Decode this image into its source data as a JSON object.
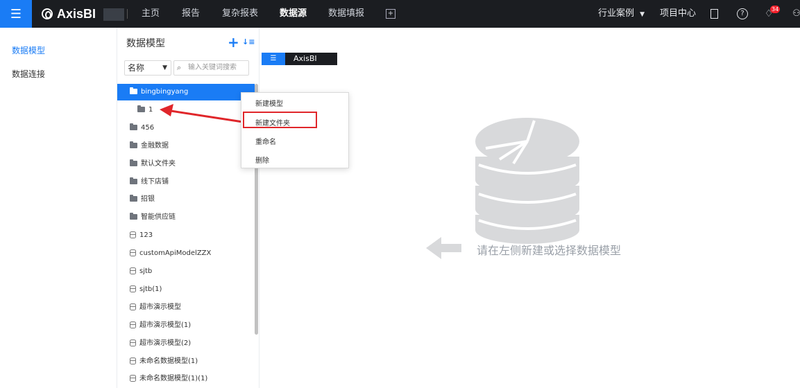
{
  "topbar": {
    "app_name": "AxisBI",
    "nav": [
      {
        "label": "主页",
        "active": false
      },
      {
        "label": "报告",
        "active": false
      },
      {
        "label": "复杂报表",
        "active": false
      },
      {
        "label": "数据源",
        "active": true
      },
      {
        "label": "数据填报",
        "active": false
      }
    ],
    "industry_cases": "行业案例",
    "project_center": "项目中心",
    "notification_count": "34"
  },
  "leftnav": {
    "items": [
      {
        "label": "数据模型",
        "active": true
      },
      {
        "label": "数据连接",
        "active": false
      }
    ]
  },
  "panel": {
    "title": "数据模型",
    "filter_field": "名称",
    "search_placeholder": "输入关键词搜索",
    "tree": [
      {
        "label": "bingbingyang",
        "type": "folder",
        "level": 0,
        "selected": true
      },
      {
        "label": "1",
        "type": "folder",
        "level": 1,
        "selected": false
      },
      {
        "label": "456",
        "type": "folder",
        "level": 0,
        "selected": false
      },
      {
        "label": "金融数据",
        "type": "folder",
        "level": 0,
        "selected": false
      },
      {
        "label": "默认文件夹",
        "type": "folder",
        "level": 0,
        "selected": false
      },
      {
        "label": "线下店铺",
        "type": "folder",
        "level": 0,
        "selected": false
      },
      {
        "label": "招银",
        "type": "folder",
        "level": 0,
        "selected": false
      },
      {
        "label": "智能供应链",
        "type": "folder",
        "level": 0,
        "selected": false
      },
      {
        "label": "123",
        "type": "model",
        "level": 0,
        "selected": false
      },
      {
        "label": "customApiModelZZX",
        "type": "model",
        "level": 0,
        "selected": false
      },
      {
        "label": "sjtb",
        "type": "model",
        "level": 0,
        "selected": false
      },
      {
        "label": "sjtb(1)",
        "type": "model",
        "level": 0,
        "selected": false
      },
      {
        "label": "超市演示模型",
        "type": "model",
        "level": 0,
        "selected": false
      },
      {
        "label": "超市演示模型(1)",
        "type": "model",
        "level": 0,
        "selected": false
      },
      {
        "label": "超市演示模型(2)",
        "type": "model",
        "level": 0,
        "selected": false
      },
      {
        "label": "未命名数据模型(1)",
        "type": "model",
        "level": 0,
        "selected": false
      },
      {
        "label": "未命名数据模型(1)(1)",
        "type": "model",
        "level": 0,
        "selected": false
      }
    ]
  },
  "mini_logo": "AxisBI",
  "context_menu": {
    "items": [
      "新建模型",
      "新建文件夹",
      "重命名",
      "删除"
    ],
    "highlighted": "新建文件夹"
  },
  "empty_state": {
    "text": "请在左侧新建或选择数据模型"
  },
  "colors": {
    "accent": "#1a7cf5",
    "topbar_bg": "#1b1d21",
    "highlight_red": "#e0262a",
    "empty_gray": "#d8d9db"
  }
}
